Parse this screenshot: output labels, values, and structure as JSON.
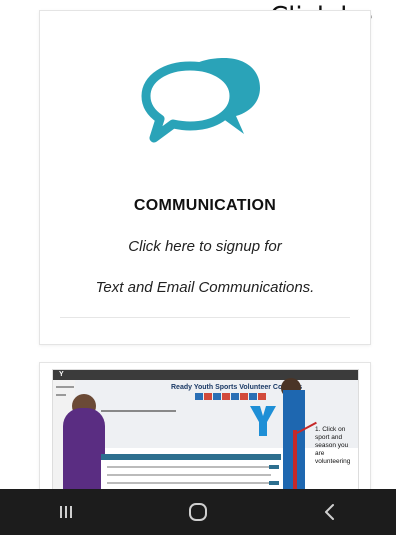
{
  "overlay": {
    "text": "Click he"
  },
  "communication_card": {
    "icon": "chat-bubbles-icon",
    "icon_color": "#2aa3b8",
    "title": "COMMUNICATION",
    "line1": "Click here to signup for",
    "line2": "Text and Email Communications."
  },
  "preview_card": {
    "heading": "Ready Youth Sports Volunteer Coaches",
    "annotation": "1. Click on sport and season you are volunteering"
  },
  "navbar": {
    "background": "#1c1c1c",
    "buttons": [
      {
        "icon": "recent-apps-icon"
      },
      {
        "icon": "home-icon"
      },
      {
        "icon": "back-icon"
      }
    ]
  }
}
